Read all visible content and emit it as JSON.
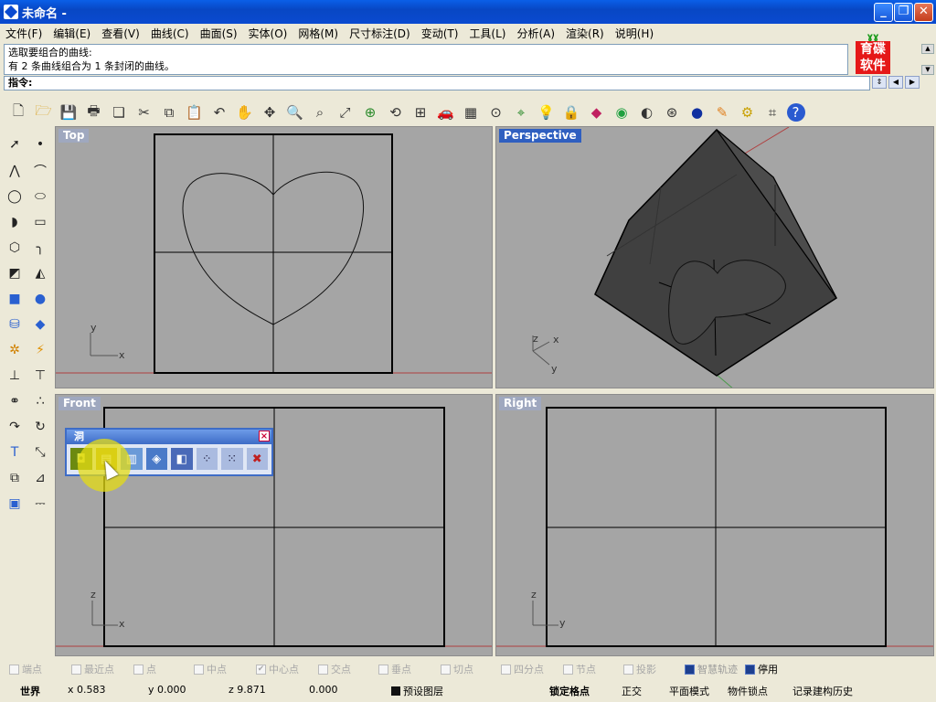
{
  "window": {
    "title": "未命名 -"
  },
  "menu": {
    "items": [
      "文件(F)",
      "编辑(E)",
      "查看(V)",
      "曲线(C)",
      "曲面(S)",
      "实体(O)",
      "网格(M)",
      "尺寸标注(D)",
      "变动(T)",
      "工具(L)",
      "分析(A)",
      "渲染(R)",
      "说明(H)"
    ]
  },
  "command": {
    "history": [
      "选取要组合的曲线:",
      "有 2 条曲线组合为 1 条封闭的曲线。"
    ],
    "prompt_label": "指令:",
    "prompt_value": ""
  },
  "logo": {
    "line1": "育碟",
    "line2": "软件"
  },
  "toolbar": {
    "icons": [
      "new-icon",
      "open-icon",
      "save-icon",
      "print-icon",
      "import-icon",
      "cut-icon",
      "copy-icon",
      "paste-icon",
      "undo-icon",
      "pan-icon",
      "rotate-view-icon",
      "zoom-icon",
      "zoom-window-icon",
      "zoom-extents-icon",
      "zoom-selected-icon",
      "undo-view-icon",
      "four-viewports-icon",
      "car-icon",
      "grid-icon",
      "snap-icon",
      "osnap-icon",
      "light-icon",
      "lock-icon",
      "layer-icon",
      "color-icon",
      "shade-icon",
      "wireframe-sphere-icon",
      "render-sphere-icon",
      "render-icon",
      "options-icon",
      "toolbar-layout-icon",
      "help-icon"
    ]
  },
  "viewports": {
    "top": {
      "label": "Top",
      "axis_x": "x",
      "axis_y": "y"
    },
    "perspective": {
      "label": "Perspective",
      "axis_x": "x",
      "axis_y": "y",
      "axis_z": "z"
    },
    "front": {
      "label": "Front",
      "axis_x": "x",
      "axis_z": "z"
    },
    "right": {
      "label": "Right",
      "axis_y": "y",
      "axis_z": "z"
    }
  },
  "hole_toolbar": {
    "title": "洞",
    "close": "×",
    "icons": [
      "make-hole-icon",
      "place-hole-icon",
      "extrude-hole-icon",
      "rotate-hole-icon",
      "move-hole-icon",
      "array-hole-icon",
      "array-hole-polar-icon",
      "delete-hole-icon"
    ]
  },
  "osnaps": [
    {
      "label": "端点",
      "checked": false
    },
    {
      "label": "最近点",
      "checked": false
    },
    {
      "label": "点",
      "checked": false
    },
    {
      "label": "中点",
      "checked": false
    },
    {
      "label": "中心点",
      "checked": true
    },
    {
      "label": "交点",
      "checked": false
    },
    {
      "label": "垂点",
      "checked": false
    },
    {
      "label": "切点",
      "checked": false
    },
    {
      "label": "四分点",
      "checked": false
    },
    {
      "label": "节点",
      "checked": false
    },
    {
      "label": "投影",
      "checked": false
    },
    {
      "label": "智慧轨迹",
      "checked": true
    },
    {
      "label": "停用",
      "checked": true
    }
  ],
  "status": {
    "cplane": "世界",
    "x": "x 0.583",
    "y": "y 0.000",
    "z": "z 9.871",
    "dist": "0.000",
    "layer": "预设图层",
    "grid_snap": "锁定格点",
    "ortho": "正交",
    "planar": "平面模式",
    "osnap": "物件锁点",
    "history": "记录建构历史"
  }
}
